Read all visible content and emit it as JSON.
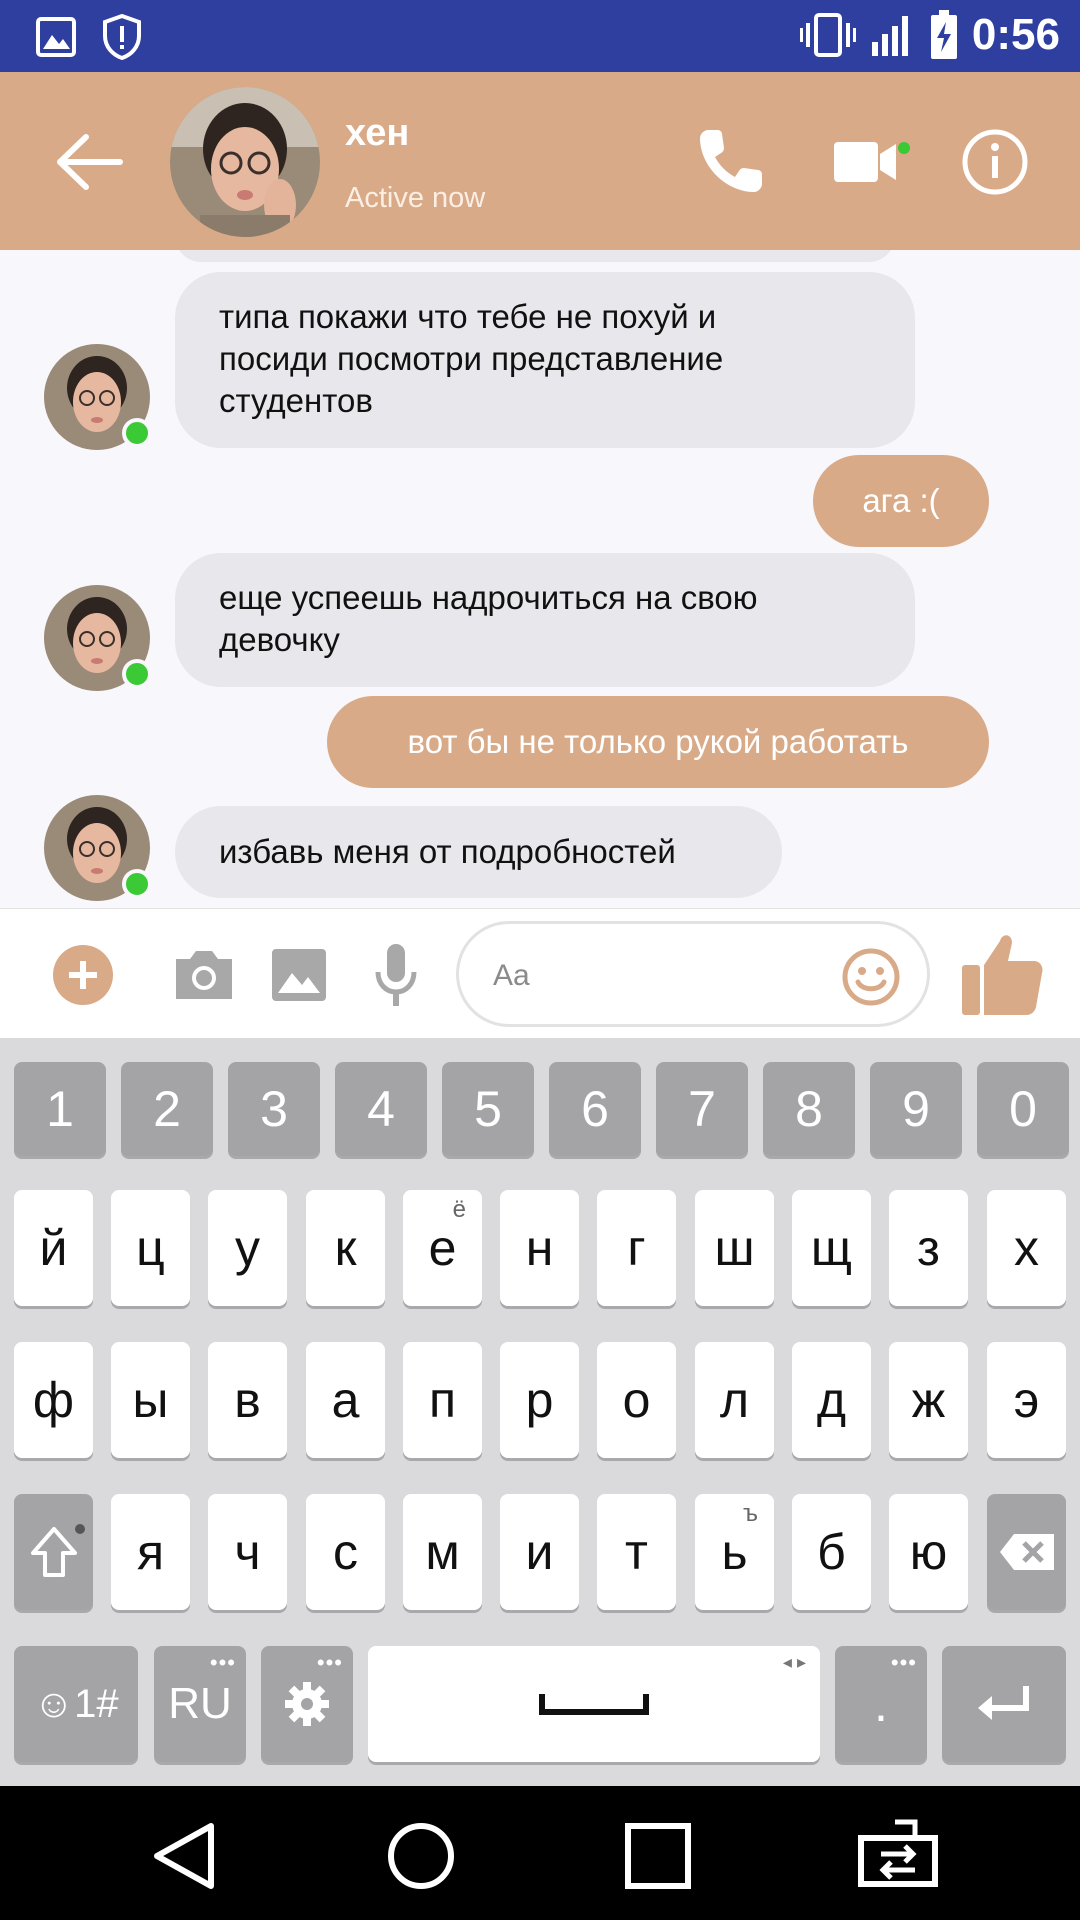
{
  "status_bar": {
    "time": "0:56",
    "icons": [
      "image-notification-icon",
      "shield-alert-icon",
      "vibrate-icon",
      "signal-icon",
      "battery-charging-icon"
    ]
  },
  "header": {
    "contact_name": "хен",
    "status": "Active now",
    "icons": [
      "back-arrow-icon",
      "phone-icon",
      "video-camera-icon",
      "info-icon"
    ]
  },
  "messages": [
    {
      "direction": "in",
      "lines": [
        "типа покажи что тебе не похуй и",
        "посиди посмотри представление",
        "студентов"
      ]
    },
    {
      "direction": "out",
      "text": "ага :("
    },
    {
      "direction": "in",
      "lines": [
        "еще успеешь надрочиться на свою",
        "девочку"
      ]
    },
    {
      "direction": "out",
      "text": "вот бы не только рукой работать"
    },
    {
      "direction": "in",
      "lines": [
        "избавь меня от подробностей"
      ]
    }
  ],
  "composer": {
    "placeholder": "Aa",
    "icons": [
      "plus-icon",
      "camera-icon",
      "gallery-icon",
      "microphone-icon",
      "emoji-icon",
      "thumbs-up-icon"
    ]
  },
  "keyboard": {
    "number_row": [
      "1",
      "2",
      "3",
      "4",
      "5",
      "6",
      "7",
      "8",
      "9",
      "0"
    ],
    "row1": [
      "й",
      "ц",
      "у",
      "к",
      "е",
      "н",
      "г",
      "ш",
      "щ",
      "з",
      "х"
    ],
    "row1_hint_e": "ё",
    "row2": [
      "ф",
      "ы",
      "в",
      "а",
      "п",
      "р",
      "о",
      "л",
      "д",
      "ж",
      "э"
    ],
    "row3": [
      "я",
      "ч",
      "с",
      "м",
      "и",
      "т",
      "ь",
      "б",
      "ю"
    ],
    "row3_hint_soft": "ъ",
    "bottom": {
      "symbols": "☺1#",
      "language": "RU",
      "period": "."
    }
  },
  "colors": {
    "status_bar": "#2f3fa0",
    "accent": "#d8aa88",
    "incoming_bubble": "#e8e7ec",
    "online": "#3bc935"
  }
}
